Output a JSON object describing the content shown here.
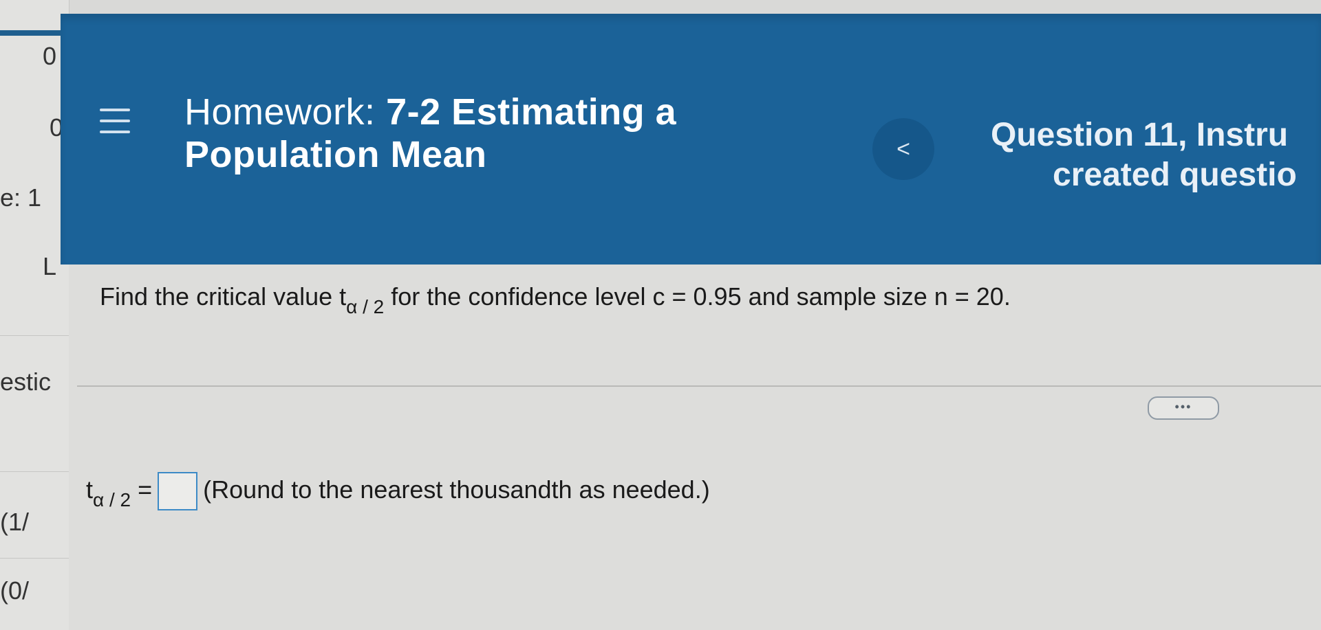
{
  "sidebar": {
    "fragments": [
      "0",
      "0",
      "e:  1",
      "L",
      "estic",
      "(1/",
      "(0/"
    ]
  },
  "header": {
    "title_prefix": "Homework:",
    "title_bold": "7-2 Estimating a",
    "title_line2": "Population Mean",
    "prev_label": "<",
    "question_line1": "Question 11, Instru",
    "question_line2": "created questio"
  },
  "question": {
    "part1": "Find the critical value t",
    "sub": "α / 2",
    "part2": " for the confidence level c = 0.95 and sample size n = 20."
  },
  "more_button": "•••",
  "answer": {
    "var": "t",
    "sub": "α / 2",
    "eq": "=",
    "note": "(Round to the nearest thousandth as needed.)"
  }
}
